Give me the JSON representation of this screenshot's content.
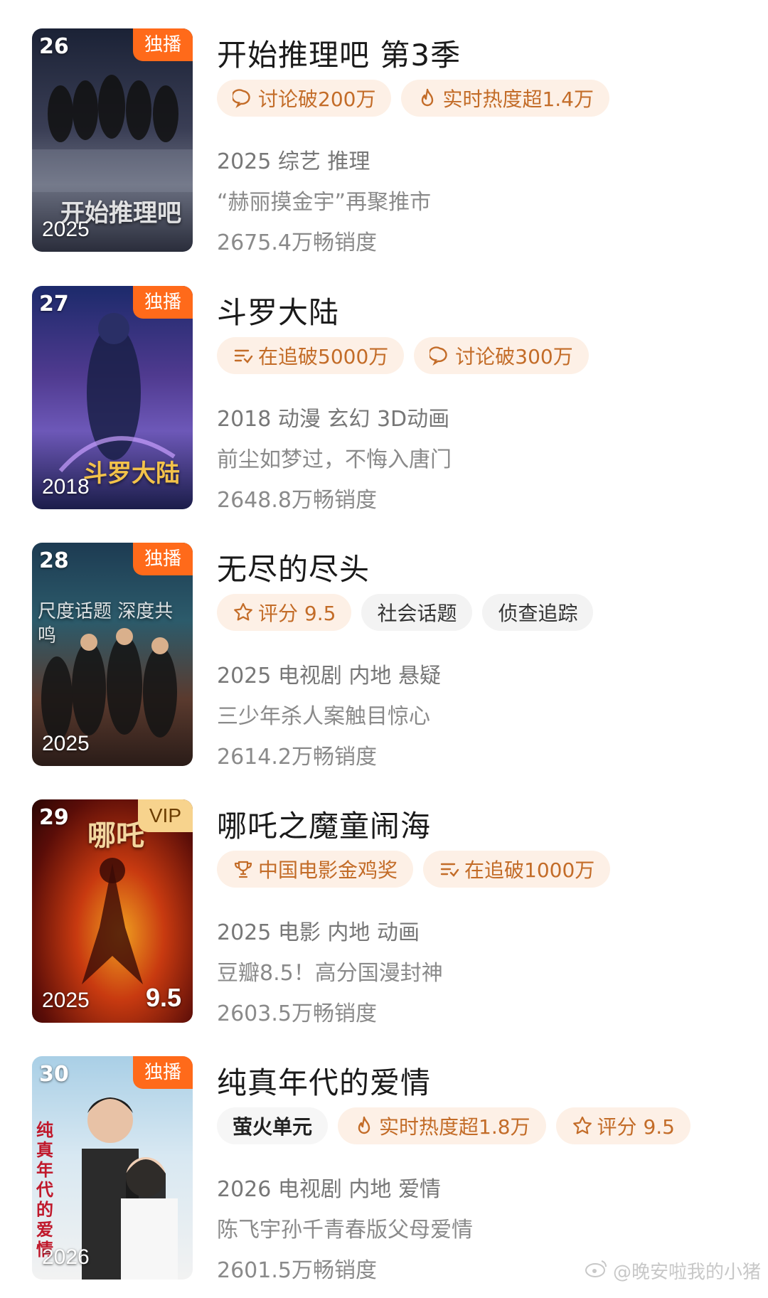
{
  "items": [
    {
      "rank": "26",
      "badge": "独播",
      "year": "2025",
      "poster_text": "开始推理吧",
      "title": "开始推理吧 第3季",
      "tags": [
        {
          "icon": "chat-bubble-icon",
          "label": "讨论破200万"
        },
        {
          "icon": "flame-icon",
          "label": "实时热度超1.4万"
        }
      ],
      "meta": "2025 综艺 推理",
      "desc": "“赫丽摸金宇”再聚推市",
      "sales": "2675.4万畅销度"
    },
    {
      "rank": "27",
      "badge": "独播",
      "year": "2018",
      "poster_text": "斗罗大陆",
      "title": "斗罗大陆",
      "tags": [
        {
          "icon": "follow-list-icon",
          "label": "在追破5000万"
        },
        {
          "icon": "chat-bubble-icon",
          "label": "讨论破300万"
        }
      ],
      "meta": "2018 动漫 玄幻 3D动画",
      "desc": "前尘如梦过，不悔入唐门",
      "sales": "2648.8万畅销度"
    },
    {
      "rank": "28",
      "badge": "独播",
      "year": "2025",
      "poster_text": "尺度话题 深度共鸣",
      "title": "无尽的尽头",
      "tags": [
        {
          "icon": "star-icon",
          "label": "评分 9.5"
        },
        {
          "icon": "",
          "label": "社会话题"
        },
        {
          "icon": "",
          "label": "侦查追踪"
        }
      ],
      "meta": "2025 电视剧 内地 悬疑",
      "desc": "三少年杀人案触目惊心",
      "sales": "2614.2万畅销度"
    },
    {
      "rank": "29",
      "badge": "VIP",
      "year": "2025",
      "score": "9.5",
      "poster_text": "哪吒",
      "title": "哪吒之魔童闹海",
      "tags": [
        {
          "icon": "trophy-icon",
          "label": "中国电影金鸡奖"
        },
        {
          "icon": "follow-list-icon",
          "label": "在追破1000万"
        }
      ],
      "meta": "2025 电影 内地 动画",
      "desc": "豆瓣8.5！高分国漫封神",
      "sales": "2603.5万畅销度"
    },
    {
      "rank": "30",
      "badge": "独播",
      "year": "2026",
      "poster_text": "纯真年代的爱情",
      "title": "纯真年代的爱情",
      "tags": [
        {
          "icon": "",
          "label": "萤火单元"
        },
        {
          "icon": "flame-icon",
          "label": "实时热度超1.8万"
        },
        {
          "icon": "star-icon",
          "label": "评分 9.5"
        }
      ],
      "meta": "2026 电视剧 内地 爱情",
      "desc": "陈飞宇孙千青春版父母爱情",
      "sales": "2601.5万畅销度"
    }
  ],
  "watermark": "@晚安啦我的小猪",
  "colors": {
    "accent": "#ff6a1a",
    "tag_bg": "#fdf0e6",
    "tag_text": "#c36c28"
  }
}
